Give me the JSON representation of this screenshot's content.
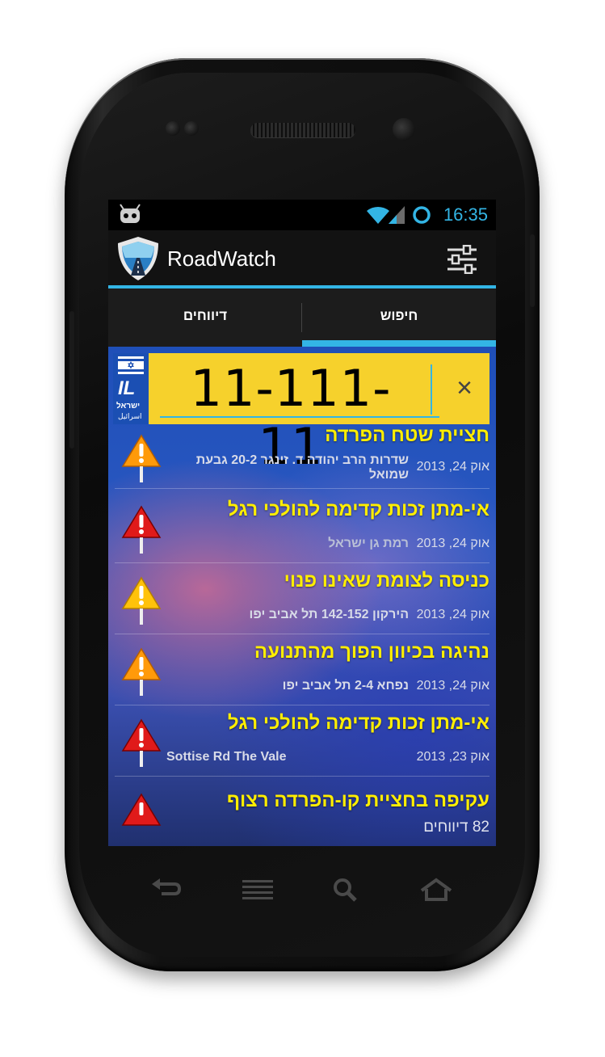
{
  "status_bar": {
    "time": "16:35",
    "notification_icon": "android-bug-icon",
    "wifi_icon": "wifi-icon",
    "signal_icon": "signal-icon",
    "sync_icon": "sync-circle-icon"
  },
  "action_bar": {
    "app_title": "RoadWatch",
    "logo_icon": "shield-road-icon",
    "settings_icon": "sliders-icon"
  },
  "tabs": [
    {
      "label": "דיווחים",
      "selected": false
    },
    {
      "label": "חיפוש",
      "selected": true
    }
  ],
  "accent_color": "#33b5e5",
  "plate": {
    "number": "11-111-11",
    "il_text": "IL",
    "country_hebrew": "ישראל",
    "country_arabic": "اسرائيل",
    "clear_icon": "close-icon"
  },
  "reports": [
    {
      "title": "חציית שטח הפרדה",
      "date": "אוק 24, 2013",
      "address_line1": "שדרות הרב יהודה ד. זינגר 20-2 גבעת",
      "address_line2": "שמואל",
      "severity": "orange"
    },
    {
      "title": "אי-מתן זכות קדימה להולכי רגל",
      "date": "אוק 24, 2013",
      "address_line1": "רמת גן ישראל",
      "address_line2": "",
      "severity": "red"
    },
    {
      "title": "כניסה לצומת שאינו פנוי",
      "date": "אוק 24, 2013",
      "address_line1": "הירקון 142-152 תל אביב יפו",
      "address_line2": "",
      "severity": "orange"
    },
    {
      "title": "נהיגה בכיוון הפוך מהתנועה",
      "date": "אוק 24, 2013",
      "address_line1": "נפחא 2-4 תל אביב יפו",
      "address_line2": "",
      "severity": "orange"
    },
    {
      "title": "אי-מתן זכות קדימה להולכי רגל",
      "date": "אוק 23, 2013",
      "address_line1": "Sottise Rd The Vale",
      "address_line2": "",
      "severity": "red"
    },
    {
      "title": "עקיפה בחציית קו-הפרדה רצוף",
      "date": "82 דיווחים",
      "address_line1": "",
      "address_line2": "",
      "severity": "red"
    }
  ],
  "nav_buttons": {
    "back_icon": "back-icon",
    "menu_icon": "menu-icon",
    "search_icon": "search-icon",
    "home_icon": "home-icon"
  }
}
